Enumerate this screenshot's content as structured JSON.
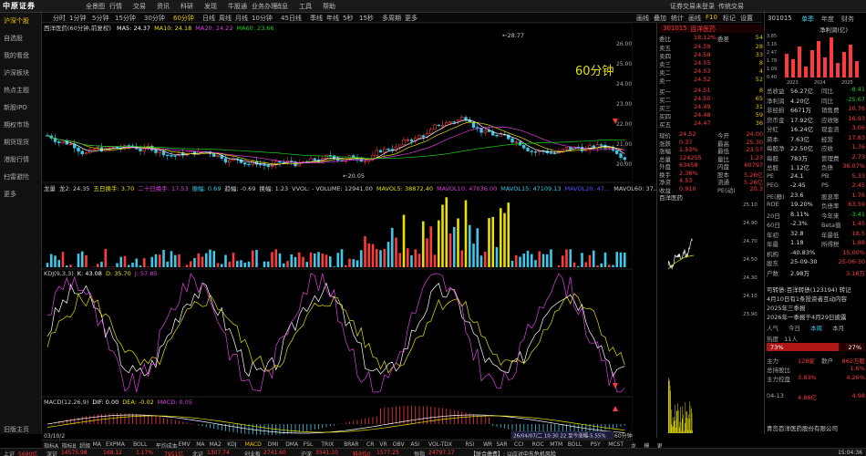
{
  "top": {
    "logo": "中原证券",
    "menus": [
      "全景图",
      "行情",
      "交易",
      "资讯",
      "科研",
      "发现",
      "牛股通",
      "业务办理",
      "消息",
      "工具",
      "帮助"
    ],
    "links": [
      "证券交易未登录",
      "传统交易"
    ]
  },
  "leftnav": [
    "沪深个股",
    "自选股",
    "我的看盘",
    "沪深板块",
    "热点主题",
    "新股IPO",
    "期权市场",
    "期货现货",
    "港股行情",
    "扫雷避险",
    "更多",
    "旧版主页"
  ],
  "toolbar": {
    "tabs": [
      "分时",
      "1分钟",
      "5分钟",
      "15分钟",
      "30分钟",
      "60分钟",
      "日线",
      "周线",
      "月线",
      "10分钟",
      "45日线",
      "季线",
      "年线",
      "5秒",
      "15秒",
      "多周期",
      "更多"
    ],
    "right": [
      "画线",
      "叠加",
      "统计",
      "画线",
      "F10",
      "标记",
      "设置"
    ]
  },
  "chart": {
    "title": "西洋医药(60分钟,前复权)",
    "ma": [
      {
        "label": "MA5: 24.37",
        "color": "#ffffff"
      },
      {
        "label": "MA10: 24.18",
        "color": "#e8e000"
      },
      {
        "label": "MA20: 24.22",
        "color": "#e040e0"
      },
      {
        "label": "MA60: 23.66",
        "color": "#19d219"
      }
    ],
    "period_label": "60分钟",
    "high_label": "28.77",
    "low_label": "20.05",
    "price_axis": [
      "26.00",
      "25.00",
      "24.00",
      "23.00",
      "22.00",
      "21.00",
      "20.00"
    ],
    "vol_legend": [
      {
        "label": "龙量",
        "color": "#ccc"
      },
      {
        "label": "龙2: 24.35",
        "color": "#ccc"
      },
      {
        "label": "五日换手: 3.70",
        "color": "#e8e000"
      },
      {
        "label": "二十日换手: 17.53",
        "color": "#e040e0"
      },
      {
        "label": "振幅: 0.69",
        "color": "#3cc8e8"
      },
      {
        "label": "趋幅: -0.69",
        "color": "#ccc"
      },
      {
        "label": "换幅: 1.23",
        "color": "#ccc"
      },
      {
        "label": "VVOL: - VOLUME: 12941.00",
        "color": "#ccc"
      },
      {
        "label": "MAVOL5: 38872.40",
        "color": "#e8e000"
      },
      {
        "label": "MAVOL10: 47036.00",
        "color": "#e040e0"
      },
      {
        "label": "MAVOL15: 47109.13",
        "color": "#3cc8e8"
      },
      {
        "label": "MAVOL20: 47...",
        "color": "#5050ff"
      },
      {
        "label": "MAVOL60: 37...",
        "color": "#ccc"
      }
    ],
    "vol_axis": [
      "25.10",
      "25.00",
      "24.90",
      "24.80",
      "24.70",
      "24.60",
      "24.50",
      "24.40",
      "24.30",
      "24.20",
      "24.15"
    ],
    "vol_side_label": "17050",
    "kdj_legend": [
      {
        "label": "KDJ(9,3,3)",
        "color": "#ccc"
      },
      {
        "label": "K: 43.08",
        "color": "#ffffff"
      },
      {
        "label": "D: 35.70",
        "color": "#e8e000"
      },
      {
        "label": "J: 57.85",
        "color": "#e040e0"
      }
    ],
    "kdj_axis": [
      "24.15",
      "24.00",
      "23.85",
      "23.70",
      "23.55",
      "23.40",
      "23.30",
      "23.16"
    ],
    "macd_legend": [
      {
        "label": "MACD(12,26,9)",
        "color": "#ccc"
      },
      {
        "label": "DIF: 0.00",
        "color": "#ffffff"
      },
      {
        "label": "DEA: -0.02",
        "color": "#e8e000"
      },
      {
        "label": "MACD: 0.05",
        "color": "#e040e0"
      }
    ],
    "macd_axis": [
      "6941",
      "6492",
      "5194",
      "3896",
      "2597",
      "1299",
      "万"
    ],
    "date_left": "03/10/2",
    "date_tooltip": "26/04/07/二 10:30 22 至今涨幅-5.55%",
    "period_bottom": "60分钟"
  },
  "quote": {
    "code": "301015",
    "name": "百洋医药",
    "weibi_label": "委比",
    "weibi": "18.12%",
    "weicha_label": "委差",
    "weicha": "54",
    "asks": [
      {
        "l": "卖五",
        "p": "24.59",
        "v": "28"
      },
      {
        "l": "卖四",
        "p": "24.58",
        "v": "33"
      },
      {
        "l": "卖三",
        "p": "24.55",
        "v": "8"
      },
      {
        "l": "卖二",
        "p": "24.53",
        "v": "4"
      },
      {
        "l": "卖一",
        "p": "24.52",
        "v": "52"
      }
    ],
    "bids": [
      {
        "l": "买一",
        "p": "24.51",
        "v": "8"
      },
      {
        "l": "买二",
        "p": "24.50",
        "v": "65"
      },
      {
        "l": "买三",
        "p": "24.49",
        "v": "31"
      },
      {
        "l": "买四",
        "p": "24.48",
        "v": "59"
      },
      {
        "l": "买五",
        "p": "24.47",
        "v": "36"
      }
    ],
    "stats": [
      {
        "a": "现价",
        "b": "24.52",
        "c": "今开",
        "d": "24.00"
      },
      {
        "a": "涨跌",
        "b": "0.37",
        "c": "最高",
        "d": "25.30"
      },
      {
        "a": "涨幅",
        "b": "1.53%",
        "c": "最低",
        "d": "23.57"
      },
      {
        "a": "总量",
        "b": "124255",
        "c": "量比",
        "d": "1.23"
      },
      {
        "a": "外盘",
        "b": "63458",
        "c": "内盘",
        "d": "60797"
      },
      {
        "a": "换手",
        "b": "2.36%",
        "c": "股本",
        "d": "5.26亿"
      },
      {
        "a": "净资",
        "b": "4.53",
        "c": "流通",
        "d": "5.26亿"
      },
      {
        "a": "收益",
        "b": "0.910",
        "c": "PE(动)",
        "d": "20.3"
      }
    ],
    "intraday_title": "百洋医药",
    "intraday_axis": [
      "25.10",
      "24.90",
      "24.70",
      "24.50",
      "24.30",
      "24.10",
      "23.90"
    ]
  },
  "funds": {
    "code": "301015",
    "tabs": [
      "单季",
      "年度",
      "财务"
    ],
    "chart_title": "净利润(亿)",
    "bar_labels": [
      "2023",
      "2024",
      "2025"
    ],
    "bar_values_text": [
      "3.85",
      "3.16",
      "2.47",
      "1.78",
      "1.09",
      "0.40"
    ],
    "rows": [
      {
        "a": "总收益",
        "b": "56.27亿",
        "c": "同比",
        "d": "-8.41"
      },
      {
        "a": "净利润",
        "b": "4.20亿",
        "c": "同比",
        "d": "-25.67"
      },
      {
        "a": "非经损",
        "b": "6671万",
        "c": "销售费",
        "d": "10.76"
      },
      {
        "a": "货币金",
        "b": "17.92亿",
        "c": "应收账",
        "d": "16.93"
      },
      {
        "a": "分红",
        "b": "16.24亿",
        "c": "现金流",
        "d": "3.06"
      },
      {
        "a": "资本",
        "b": "7.63亿",
        "c": "经营",
        "d": "17.83"
      },
      {
        "a": "每股净",
        "b": "22.50亿",
        "c": "应收",
        "d": "1.76"
      },
      {
        "a": "每股",
        "b": "783万",
        "c": "管理费",
        "d": "2.73"
      },
      {
        "a": "总股",
        "b": "1.12亿",
        "c": "负债",
        "d": "36.07%"
      },
      {
        "a": "PE",
        "b": "24.1",
        "c": "PB",
        "d": "5.33"
      },
      {
        "a": "PEG",
        "b": "-2.45",
        "c": "PS",
        "d": "2.45"
      },
      {
        "a": "PE(静)",
        "b": "23.6",
        "c": "股息率",
        "d": "1.76"
      },
      {
        "a": "ROE",
        "b": "19.20%",
        "c": "负债率",
        "d": "63.59"
      },
      {
        "a": "20日",
        "b": "8.11%",
        "c": "今年来",
        "d": "-3.41"
      },
      {
        "a": "60日",
        "b": "-2.3%",
        "c": "Beta值",
        "d": "1.45"
      },
      {
        "a": "年初",
        "b": "32.8",
        "c": "年最低",
        "d": "18.5"
      },
      {
        "a": "年最",
        "b": "1.18",
        "c": "所得税",
        "d": "1.88"
      },
      {
        "a": "机构",
        "b": "-40.83%",
        "c": "",
        "d": "15.00%"
      },
      {
        "a": "股东",
        "b": "25-09-30",
        "c": "",
        "d": "25-06-30"
      },
      {
        "a": "户数",
        "b": "2.98万",
        "c": "",
        "d": "3.18万"
      }
    ],
    "convertible": "可转债:百洋转债(123194) 转记",
    "news1": "4月10日有1条投资者互动内容",
    "news2": "2025年三季报",
    "news3": "2026年一季报于4月29日披露",
    "hot_tabs": [
      "人气",
      "今日",
      "本周",
      "本月"
    ],
    "hot_label": "热度",
    "hot_value": "11人",
    "hot_pct1": "73%",
    "hot_pct2": "27%",
    "sell_rows": [
      {
        "a": "主力",
        "b": "128家",
        "c": "散户",
        "d": "862万股"
      },
      {
        "a": "总持股比",
        "b": "",
        "c": "",
        "d": "1.6%"
      },
      {
        "a": "主力控盘",
        "b": "3.83%",
        "c": "",
        "d": "4.26%"
      },
      {
        "a": "",
        "b": "",
        "c": "",
        "d": ""
      },
      {
        "a": "04-13",
        "b": "4.86亿",
        "c": "",
        "d": "4.98"
      }
    ],
    "company": "青岛百洋医药股份有限公司"
  },
  "indicators": [
    "指标A",
    "指标B",
    "超级",
    "MA",
    "EXPMA",
    "BOLL",
    "平均成本",
    "EMV",
    "MA",
    "MA2",
    "KDJ",
    "MACD",
    "DMI",
    "DMA",
    "FSL",
    "TRIX",
    "BRAR",
    "CR",
    "VR",
    "OBV",
    "ASI",
    "VOL-TDX",
    "RSI",
    "WR",
    "SAR",
    "CCI",
    "ROC",
    "MTM",
    "BOLL",
    "PSY",
    "MCST",
    "龙线",
    "模板",
    "更多"
  ],
  "bottom": {
    "items": [
      "上证",
      "5690亿",
      "深证",
      "14575.98",
      "168.12",
      "1.17%",
      "7951亿",
      "北证",
      "1307.74",
      "创业板",
      "2741.60",
      "沪深",
      "3541.10",
      "科创50",
      "1577.25",
      "恒指",
      "24797.17"
    ],
    "news": "【联合缴费】: 以应对中东危机风险",
    "clock": "15:04:36"
  },
  "colors": {
    "up": "#ff3a3a",
    "down": "#19d219",
    "ma5": "#ffffff",
    "ma10": "#e8e000",
    "ma20": "#e040e0",
    "ma60": "#19d219"
  }
}
